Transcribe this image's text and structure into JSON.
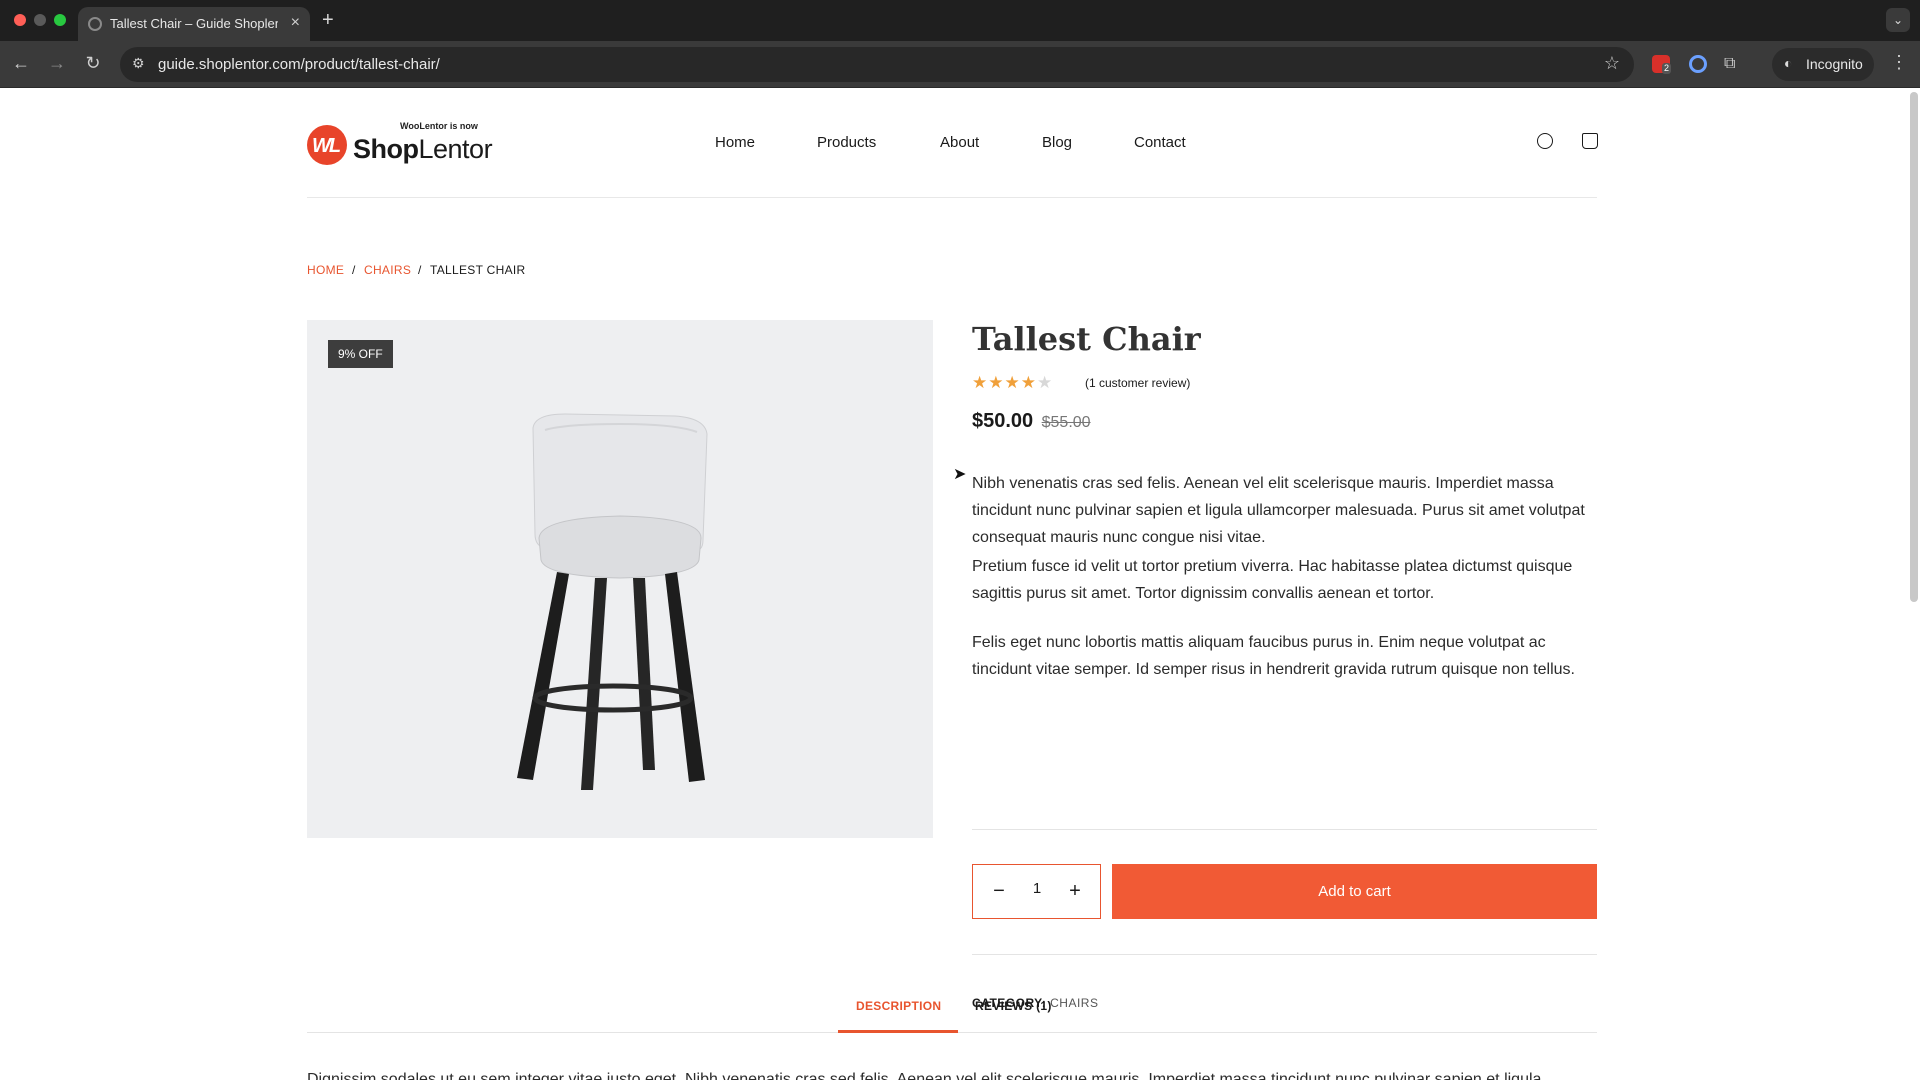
{
  "browser": {
    "tab_title": "Tallest Chair – Guide Shoplentor",
    "url": "guide.shoplentor.com/product/tallest-chair/",
    "incognito_label": "Incognito",
    "extension_badge": "2"
  },
  "header": {
    "logo_tagline": "WooLentor is now",
    "logo_name_bold": "Shop",
    "logo_name_rest": "Lentor",
    "logo_mark": "WL",
    "nav": [
      "Home",
      "Products",
      "About",
      "Blog",
      "Contact"
    ]
  },
  "breadcrumb": {
    "items": [
      "HOME",
      "CHAIRS",
      "TALLEST CHAIR"
    ],
    "separator": "/"
  },
  "product": {
    "badge": "9% OFF",
    "title": "Tallest Chair",
    "rating": 4,
    "rating_max": 5,
    "review_count_text": "(1 customer review)",
    "price_current": "$50.00",
    "price_original": "$55.00",
    "description": [
      "Nibh venenatis cras sed felis. Aenean vel elit scelerisque mauris. Imperdiet massa tincidunt nunc pulvinar sapien et ligula ullamcorper malesuada. Purus sit amet volutpat consequat mauris nunc congue nisi vitae.",
      "Pretium fusce id velit ut tortor pretium viverra. Hac habitasse platea dictumst quisque sagittis purus sit amet. Tortor dignissim convallis aenean et tortor.",
      "Felis eget nunc lobortis mattis aliquam faucibus purus in. Enim neque volutpat ac tincidunt vitae semper. Id semper risus in hendrerit gravida rutrum quisque non tellus."
    ],
    "quantity": "1",
    "add_to_cart_label": "Add to cart",
    "category_label": "CATEGORY:",
    "category_value": "CHAIRS"
  },
  "tabs": {
    "items": [
      "DESCRIPTION",
      "REVIEWS (1)"
    ],
    "active": "DESCRIPTION",
    "body_text": "Dignissim sodales ut eu sem integer vitae justo eget. Nibh venenatis cras sed felis. Aenean vel elit scelerisque mauris. Imperdiet massa tincidunt nunc pulvinar sapien et ligula"
  },
  "colors": {
    "accent": "#f15a35",
    "link": "#e8552f",
    "badge_bg": "#3d3d3d",
    "gallery_bg": "#eeeff1",
    "star_on": "#f0a03a",
    "star_off": "#d8d8d8"
  }
}
